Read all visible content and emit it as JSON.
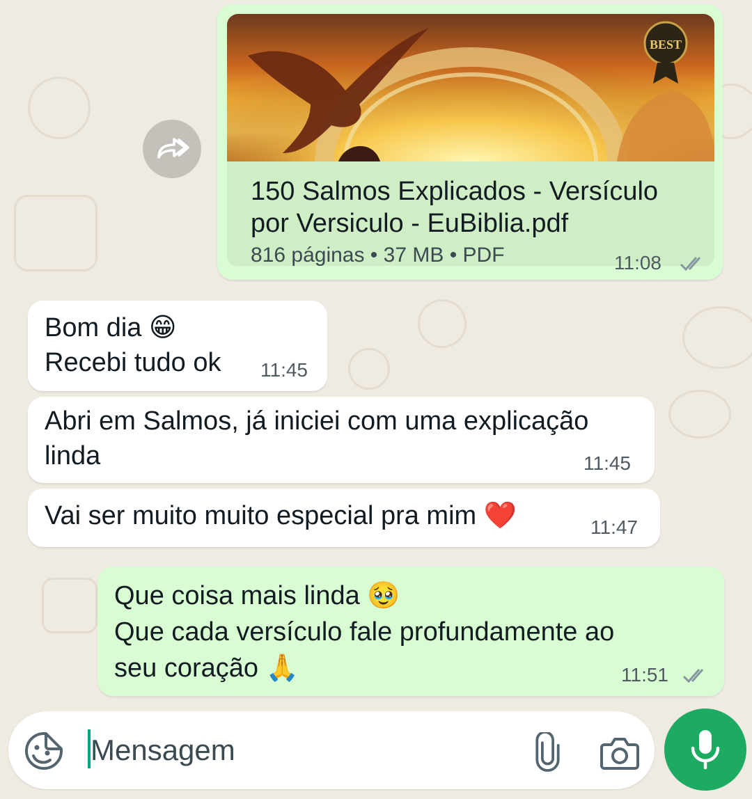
{
  "colors": {
    "background": "#efeae2",
    "outgoing_bubble": "#d9fdd3",
    "incoming_bubble": "#ffffff",
    "read_ticks": "#8696a0",
    "accent": "#1daa61"
  },
  "messages": [
    {
      "direction": "outgoing",
      "type": "document",
      "file_name_line1": "150 Salmos Explicados - Versículo",
      "file_name_line2": "por Versiculo - EuBiblia.pdf",
      "meta": "816 páginas • 37 MB • PDF",
      "time": "11:08",
      "status_icon": "double-check-icon",
      "thumbnail_badge": "BEST"
    },
    {
      "direction": "incoming",
      "line1": "Bom dia 😁",
      "line2": "Recebi tudo ok",
      "time": "11:45"
    },
    {
      "direction": "incoming",
      "line1": "Abri em Salmos, já iniciei com uma explicação",
      "line2": "linda",
      "time": "11:45"
    },
    {
      "direction": "incoming",
      "line1": "Vai ser muito muito especial pra mim ❤️",
      "time": "11:47"
    },
    {
      "direction": "outgoing",
      "line1": "Que coisa mais linda 🥹",
      "line2": "Que cada versículo fale profundamente ao",
      "line3": "seu coração 🙏",
      "time": "11:51",
      "status_icon": "double-check-icon"
    }
  ],
  "composer": {
    "placeholder": "Mensagem",
    "emoji_icon": "sticker-emoji-icon",
    "attach_icon": "paperclip-icon",
    "camera_icon": "camera-icon",
    "send_icon": "microphone-icon"
  }
}
